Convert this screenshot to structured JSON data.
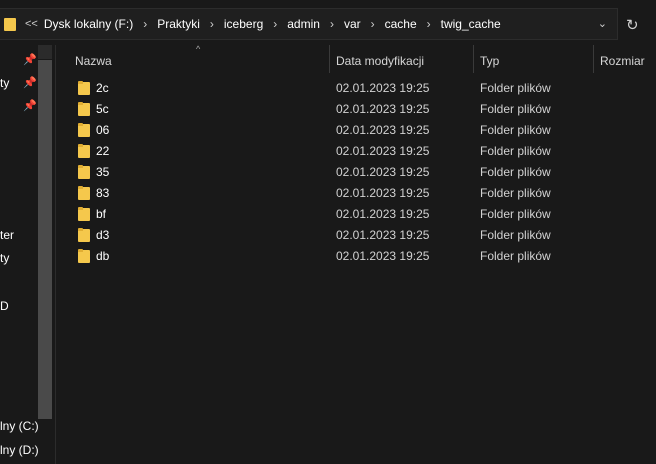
{
  "address_bar": {
    "overflow_label": "<<",
    "crumbs": [
      "Dysk lokalny (F:)",
      "Praktyki",
      "iceberg",
      "admin",
      "var",
      "cache",
      "twig_cache"
    ],
    "dropdown_icon": "chevron-down-icon",
    "refresh_icon": "refresh-icon"
  },
  "nav": {
    "items": [
      "ty",
      "ter",
      "ty",
      "D",
      "lny (C:)",
      "lny (D:)"
    ]
  },
  "columns": {
    "name": "Nazwa",
    "date": "Data modyfikacji",
    "type": "Typ",
    "size": "Rozmiar"
  },
  "rows": [
    {
      "name": "2c",
      "date": "02.01.2023 19:25",
      "type": "Folder plików"
    },
    {
      "name": "5c",
      "date": "02.01.2023 19:25",
      "type": "Folder plików"
    },
    {
      "name": "06",
      "date": "02.01.2023 19:25",
      "type": "Folder plików"
    },
    {
      "name": "22",
      "date": "02.01.2023 19:25",
      "type": "Folder plików"
    },
    {
      "name": "35",
      "date": "02.01.2023 19:25",
      "type": "Folder plików"
    },
    {
      "name": "83",
      "date": "02.01.2023 19:25",
      "type": "Folder plików"
    },
    {
      "name": "bf",
      "date": "02.01.2023 19:25",
      "type": "Folder plików"
    },
    {
      "name": "d3",
      "date": "02.01.2023 19:25",
      "type": "Folder plików"
    },
    {
      "name": "db",
      "date": "02.01.2023 19:25",
      "type": "Folder plików"
    }
  ],
  "colors": {
    "background": "#191919",
    "folder": "#f5c84c"
  }
}
